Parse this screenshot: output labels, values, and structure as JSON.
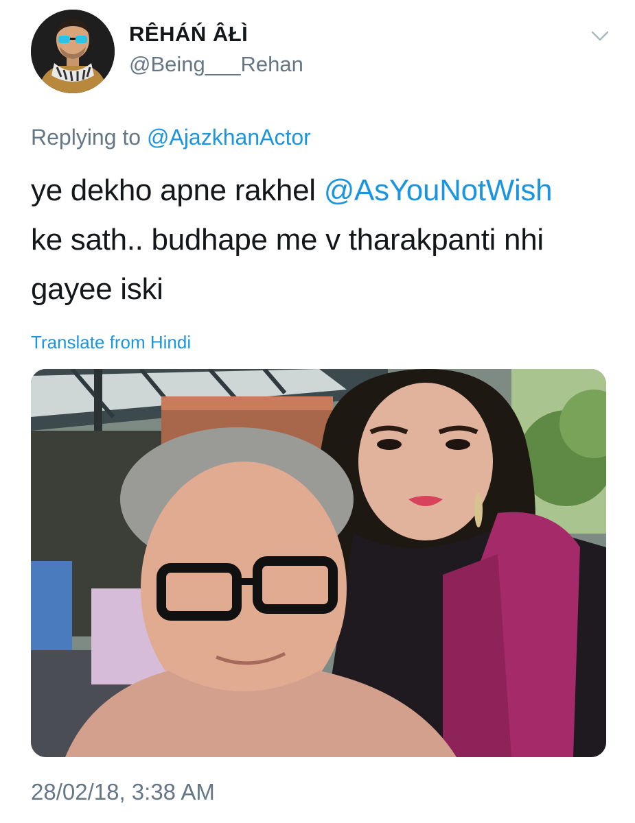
{
  "tweet": {
    "author": {
      "display_name": "RÊHÁŃ ÂŁÌ",
      "handle": "@Being___Rehan"
    },
    "reply_context": {
      "prefix": "Replying to",
      "mention": "@AjazkhanActor"
    },
    "text": {
      "part1": "ye dekho apne rakhel ",
      "mention": "@AsYouNotWish",
      "part2": "ke sath.. budhape me v tharakpanti nhi gayee iski"
    },
    "translate_label": "Translate from Hindi",
    "timestamp": "28/02/18, 3:38 AM"
  },
  "colors": {
    "link": "#1b95e0",
    "secondary_text": "#657786",
    "primary_text": "#14171a"
  },
  "icons": {
    "menu": "chevron-down-icon",
    "avatar": "user-avatar"
  }
}
